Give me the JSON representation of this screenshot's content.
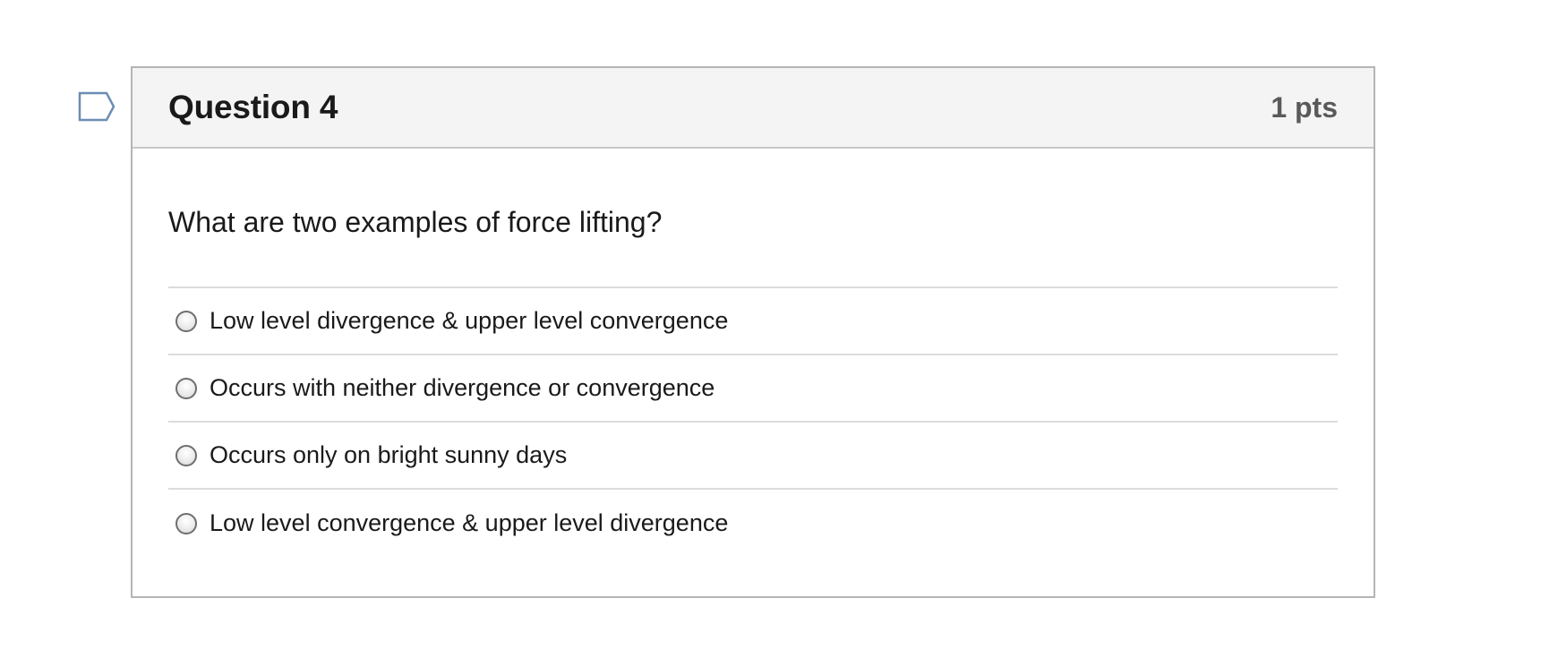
{
  "question": {
    "title": "Question 4",
    "points": "1 pts",
    "text": "What are two examples of force lifting?",
    "flag_icon": "flag-icon",
    "answers": [
      {
        "label": "Low level divergence & upper level convergence",
        "selected": false
      },
      {
        "label": "Occurs with neither divergence or convergence",
        "selected": false
      },
      {
        "label": "Occurs only on bright sunny days",
        "selected": false
      },
      {
        "label": "Low level convergence & upper level divergence",
        "selected": false
      }
    ]
  },
  "colors": {
    "header_bg": "#f4f4f4",
    "border": "#b5b5b5",
    "flag_stroke": "#6b8db5",
    "points_text": "#5a5a5a"
  }
}
